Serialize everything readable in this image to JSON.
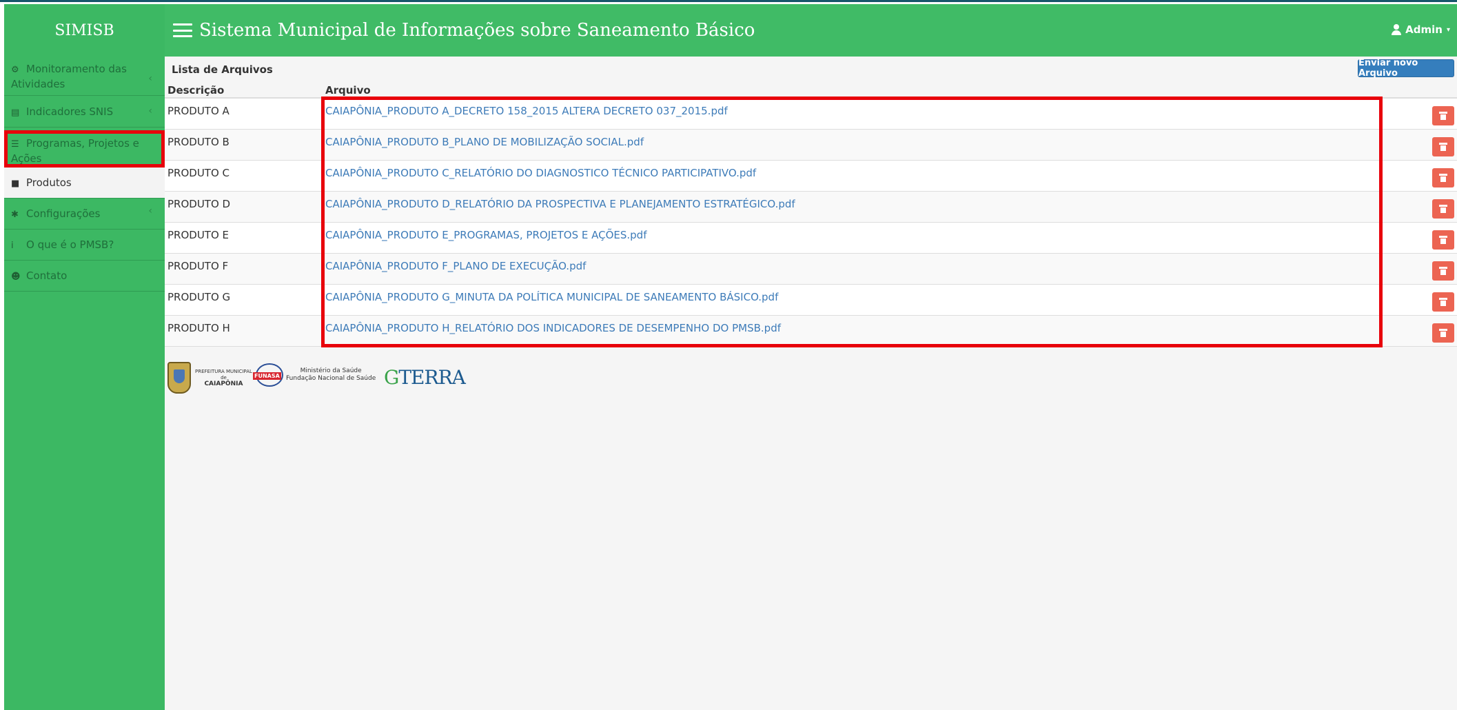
{
  "app": {
    "brand": "SIMISB",
    "title": "Sistema Municipal de Informações sobre Saneamento Básico",
    "user_label": "Admin",
    "user_caret": "▾"
  },
  "sidebar": {
    "items": [
      {
        "label": "Monitoramento das Atividades",
        "icon": "dashboard-icon",
        "chevron": "‹"
      },
      {
        "label": "Indicadores SNIS",
        "icon": "table-icon",
        "chevron": "‹"
      },
      {
        "label": "Programas, Projetos e Ações",
        "icon": "list-icon",
        "chevron": ""
      },
      {
        "label": "Produtos",
        "icon": "folder-icon",
        "chevron": ""
      },
      {
        "label": "Configurações",
        "icon": "gear-icon",
        "chevron": "‹"
      },
      {
        "label": "O que é o PMSB?",
        "icon": "info-icon",
        "chevron": ""
      },
      {
        "label": "Contato",
        "icon": "group-icon",
        "chevron": ""
      }
    ],
    "active": "Produtos"
  },
  "main": {
    "list_title": "Lista de Arquivos",
    "send_button": "Enviar novo Arquivo",
    "columns": [
      "Descrição",
      "Arquivo"
    ],
    "rows": [
      {
        "descricao": "PRODUTO A",
        "arquivo": "CAIAPÔNIA_PRODUTO A_DECRETO 158_2015 ALTERA DECRETO 037_2015.pdf"
      },
      {
        "descricao": "PRODUTO B",
        "arquivo": "CAIAPÔNIA_PRODUTO B_PLANO DE MOBILIZAÇÃO SOCIAL.pdf"
      },
      {
        "descricao": "PRODUTO C",
        "arquivo": "CAIAPÔNIA_PRODUTO C_RELATÓRIO DO DIAGNOSTICO TÉCNICO PARTICIPATIVO.pdf"
      },
      {
        "descricao": "PRODUTO D",
        "arquivo": "CAIAPÔNIA_PRODUTO D_RELATÓRIO DA PROSPECTIVA E PLANEJAMENTO ESTRATÉGICO.pdf"
      },
      {
        "descricao": "PRODUTO E",
        "arquivo": "CAIAPÔNIA_PRODUTO E_PROGRAMAS, PROJETOS E AÇÕES.pdf"
      },
      {
        "descricao": "PRODUTO F",
        "arquivo": "CAIAPÔNIA_PRODUTO F_PLANO DE EXECUÇÃO.pdf"
      },
      {
        "descricao": "PRODUTO G",
        "arquivo": "CAIAPÔNIA_PRODUTO G_MINUTA DA POLÍTICA MUNICIPAL DE SANEAMENTO BÁSICO.pdf"
      },
      {
        "descricao": "PRODUTO H",
        "arquivo": "CAIAPÔNIA_PRODUTO H_RELATÓRIO DOS INDICADORES DE DESEMPENHO DO PMSB.pdf"
      }
    ]
  },
  "footer_logos": {
    "prefeitura_line1": "PREFEITURA MUNICIPAL",
    "prefeitura_line2": "de",
    "prefeitura_name": "CAIAPÔNIA",
    "funasa_badge": "FUNASA",
    "funasa_line1": "Ministério da Saúde",
    "funasa_line2": "Fundação Nacional de Saúde",
    "terra_logo_letter": "G",
    "terra_logo_rest": "TERRA"
  },
  "colors": {
    "sidebar": "#3cb863",
    "navbar": "#40bb66",
    "link": "#3d7bb8",
    "send_button": "#357ebd",
    "delete_button": "#ec6452",
    "highlight": "#e8000b"
  }
}
